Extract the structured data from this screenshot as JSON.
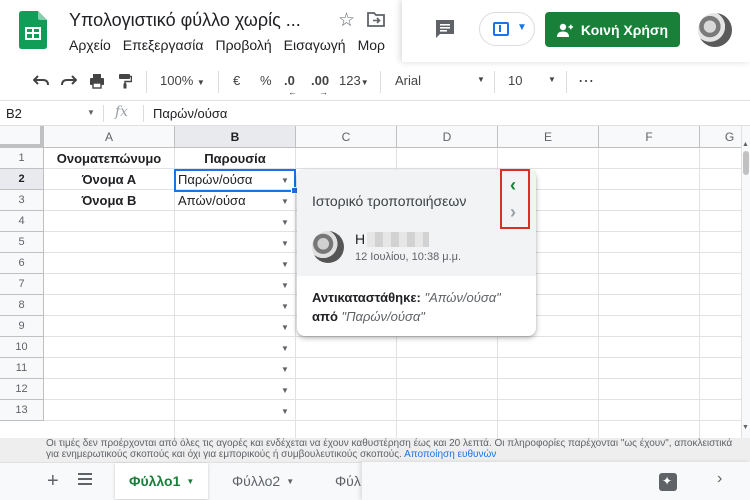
{
  "header": {
    "title": "Υπολογιστικό φύλλο χωρίς ...",
    "menu": [
      "Αρχείο",
      "Επεξεργασία",
      "Προβολή",
      "Εισαγωγή",
      "Μορ"
    ],
    "share_label": "Κοινή Χρήση",
    "icons": {
      "logo": "sheets-logo-icon",
      "star": "star-icon",
      "move": "move-to-folder-icon",
      "comments": "comment-history-icon",
      "present": "present-icon",
      "share": "person-icon"
    }
  },
  "toolbar": {
    "zoom": "100%",
    "currency": "€",
    "percent": "%",
    "dec_decrease": ".0",
    "dec_increase": ".00",
    "more_formats": "123",
    "font": "Arial",
    "font_size": "10",
    "more": "⋯"
  },
  "formula_bar": {
    "cell_ref": "B2",
    "fx": "fx",
    "value": "Παρών/ούσα"
  },
  "grid": {
    "columns": [
      "A",
      "B",
      "C",
      "D",
      "E",
      "F",
      "G"
    ],
    "rows": [
      "1",
      "2",
      "3",
      "4",
      "5",
      "6",
      "7",
      "8",
      "9",
      "10",
      "11",
      "12",
      "13"
    ],
    "cells": {
      "a1": "Ονοματεπώνυμο",
      "b1": "Παρουσία",
      "a2": "Όνομα Α",
      "b2": "Παρών/ούσα",
      "a3": "Όνομα Β",
      "b3": "Απών/ούσα"
    }
  },
  "history_popup": {
    "title": "Ιστορικό τροποποιήσεων",
    "author_initial": "Η",
    "timestamp": "12 Ιουλίου, 10:38 μ.μ.",
    "replaced_label": "Αντικαταστάθηκε:",
    "new_value": "\"Απών/ούσα\"",
    "from_label": "από",
    "old_value": "\"Παρών/ούσα\""
  },
  "footer": {
    "disclaimer": "Οι τιμές δεν προέρχονται από όλες τις αγορές και ενδέχεται να έχουν καθυστέρηση έως και 20 λεπτά. Οι πληροφορίες παρέχονται \"ως έχουν\", αποκλειστικά για ενημερωτικούς σκοπούς και όχι για εμπορικούς ή συμβουλευτικούς σκοπούς.",
    "disclaimer_link": "Αποποίηση ευθυνών",
    "sheets": [
      "Φύλλο1",
      "Φύλλο2",
      "Φύλ"
    ]
  },
  "colors": {
    "accent_green": "#188038",
    "selection_blue": "#1a73e8",
    "highlight_red": "#d93025"
  }
}
